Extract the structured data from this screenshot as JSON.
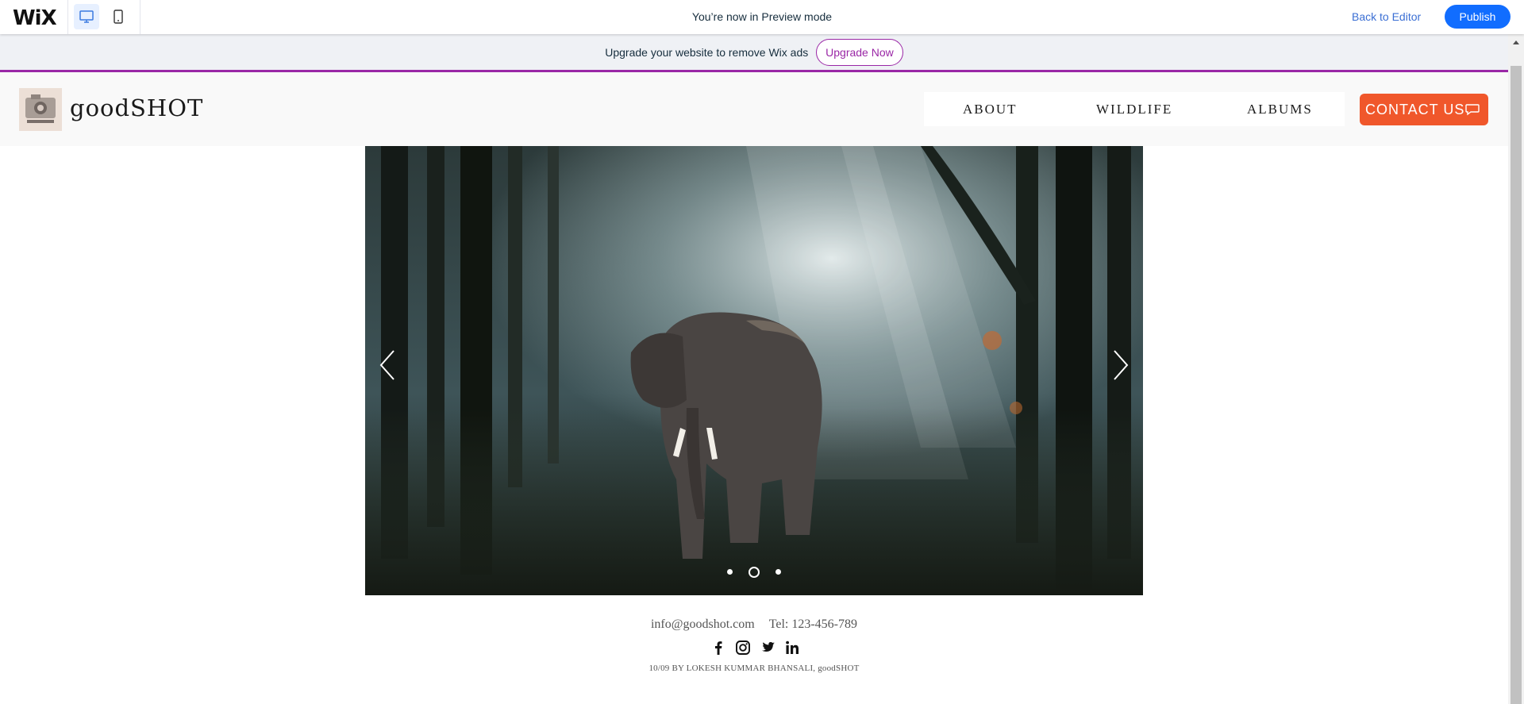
{
  "wix_bar": {
    "logo": "WiX",
    "preview_text": "You’re now in Preview mode",
    "back_to_editor": "Back to Editor",
    "publish": "Publish"
  },
  "upgrade_banner": {
    "message": "Upgrade your website to remove Wix ads",
    "button": "Upgrade Now"
  },
  "site_header": {
    "brand": "goodSHOT",
    "nav": [
      "ABOUT",
      "WILDLIFE",
      "ALBUMS"
    ],
    "contact_button": "CONTACT US"
  },
  "slideshow": {
    "image_subject": "elephant in misty forest",
    "slide_count": 3,
    "active_slide": 2
  },
  "footer": {
    "email": "info@goodshot.com",
    "phone": "Tel: 123-456-789",
    "social": [
      "facebook-icon",
      "instagram-icon",
      "twitter-icon",
      "linkedin-icon"
    ],
    "copyright": "10/09 BY LOKESH KUMMAR BHANSALI, goodSHOT"
  },
  "colors": {
    "publish": "#116dff",
    "upgrade_accent": "#9a27a6",
    "contact_button": "#f0572b"
  }
}
